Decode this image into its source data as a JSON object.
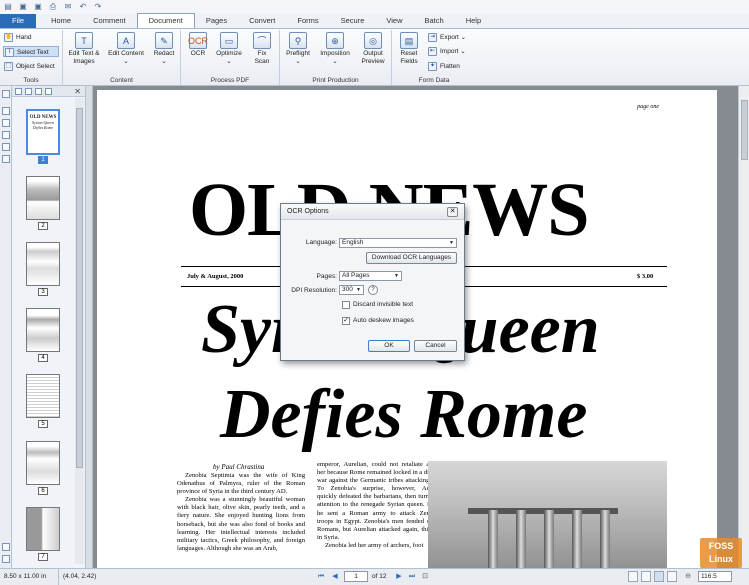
{
  "colors": {
    "accent": "#2b6cb8",
    "doc_bg": "#868b91",
    "selected": "#3d7fd6"
  },
  "qat": {
    "icons": [
      "app-menu-icon",
      "save-icon",
      "save-as-icon",
      "print-icon",
      "email-icon",
      "undo-icon",
      "redo-icon"
    ]
  },
  "tabs": [
    "File",
    "Home",
    "Comment",
    "Document",
    "Pages",
    "Convert",
    "Forms",
    "Secure",
    "View",
    "Batch",
    "Help"
  ],
  "ribbon": {
    "tools": {
      "label": "Tools",
      "hand": "Hand",
      "select_text": "Select Text",
      "object_select": "Object Select"
    },
    "content": {
      "label": "Content",
      "edit_text_images": "Edit Text &",
      "edit_text_images2": "Images",
      "edit_content": "Edit Content",
      "redact": "Redact"
    },
    "process": {
      "label": "Process PDF",
      "ocr": "OCR",
      "optimize": "Optimize",
      "fix_scan": "Fix",
      "fix_scan2": "Scan"
    },
    "print": {
      "label": "Print Production",
      "preflight": "Preflight",
      "imposition": "Imposition",
      "output_preview": "Output",
      "output_preview2": "Preview"
    },
    "form": {
      "label": "Form Data",
      "reset_fields": "Reset",
      "reset_fields2": "Fields",
      "export": "Export",
      "import": "Import",
      "flatten": "Flatten"
    }
  },
  "thumbnails": {
    "pages": [
      "1",
      "2",
      "3",
      "4",
      "5",
      "6",
      "7"
    ],
    "selected": "1"
  },
  "document": {
    "page_label": "page one",
    "masthead": "OLD NEWS",
    "dateline": "July & August, 2000",
    "price": "$ 3.00",
    "headline_line1": "Syrian Queen",
    "headline_line2": "Defies Rome",
    "byline": "by Paul Chrastina",
    "col1": [
      "Zenobia Septimia was the wife of King Odenathus of Palmyra, ruler of the Roman province of Syria in the third century AD.",
      "Zenobia was a stunningly beautiful woman with black hair, olive skin, pearly teeth, and a fiery nature. She enjoyed hunting lions from horseback, but she was also fond of books and learning. Her intellectual interests included military tactics, Greek philosophy, and foreign languages. Although she was an Arab,"
    ],
    "col2": [
      "emperor, Aurelian, could not retaliate against her because Rome remained locked in a difficult war against the Germanic tribes attacking Italy. To Zenobia's surprise, however, Aurelian quickly defeated the barbarians, then turned his attention to the renegade Syrian queen. In 272 he sent a Roman army to attack Zenobia's troops in Egypt. Zenobia's men fended off the Romans, but Aurelian attacked again, this time in Syria.",
      "Zenobia led her army of archers, foot"
    ]
  },
  "dialog": {
    "title": "OCR Options",
    "language_label": "Language:",
    "language_value": "English",
    "download_button": "Download OCR Languages",
    "pages_label": "Pages:",
    "pages_value": "All Pages",
    "dpi_label": "DPI Resolution:",
    "dpi_value": "300",
    "help": "?",
    "discard_label": "Discard invisible text",
    "discard_checked": false,
    "deskew_label": "Auto deskew images",
    "deskew_checked": true,
    "ok": "OK",
    "cancel": "Cancel"
  },
  "status": {
    "size": "8.50 x 11.00 in",
    "coords": "(4.04, 2.42)",
    "page": "1",
    "of_pages": "of 12",
    "zoom": "116.5"
  },
  "watermark": {
    "line1": "FOSS",
    "line2": "Linux"
  }
}
